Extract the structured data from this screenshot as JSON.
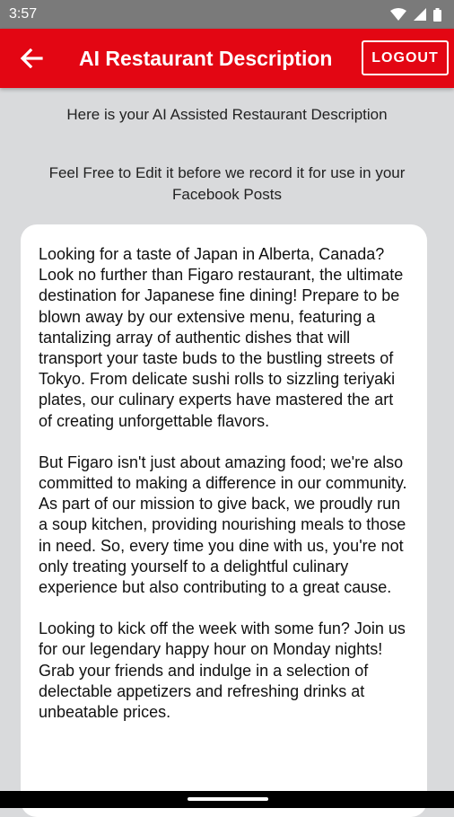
{
  "status_bar": {
    "time": "3:57",
    "icons": [
      "wifi-icon",
      "signal-icon",
      "battery-icon"
    ]
  },
  "app_bar": {
    "back_icon": "arrow-left-icon",
    "title": "AI Restaurant Description",
    "logout_label": "LOGOUT",
    "background_color": "#e30613"
  },
  "intro": {
    "heading": "Here is your AI Assisted Restaurant Description",
    "subheading": "Feel Free to Edit it before we record it for use in your Facebook Posts"
  },
  "description": {
    "paragraphs": [
      "Looking for a taste of Japan in Alberta, Canada? Look no further than Figaro restaurant, the ultimate destination for Japanese fine dining! Prepare to be blown away by our extensive menu, featuring a tantalizing array of authentic dishes that will transport your taste buds to the bustling streets of Tokyo. From delicate sushi rolls to sizzling teriyaki plates, our culinary experts have mastered the art of creating unforgettable flavors.",
      "But Figaro isn't just about amazing food; we're also committed to making a difference in our community. As part of our mission to give back, we proudly run a soup kitchen, providing nourishing meals to those in need. So, every time you dine with us, you're not only treating yourself to a delightful culinary experience but also contributing to a great cause.",
      "Looking to kick off the week with some fun? Join us for our legendary happy hour on Monday nights! Grab your friends and indulge in a selection of delectable appetizers and refreshing drinks at unbeatable prices."
    ]
  }
}
